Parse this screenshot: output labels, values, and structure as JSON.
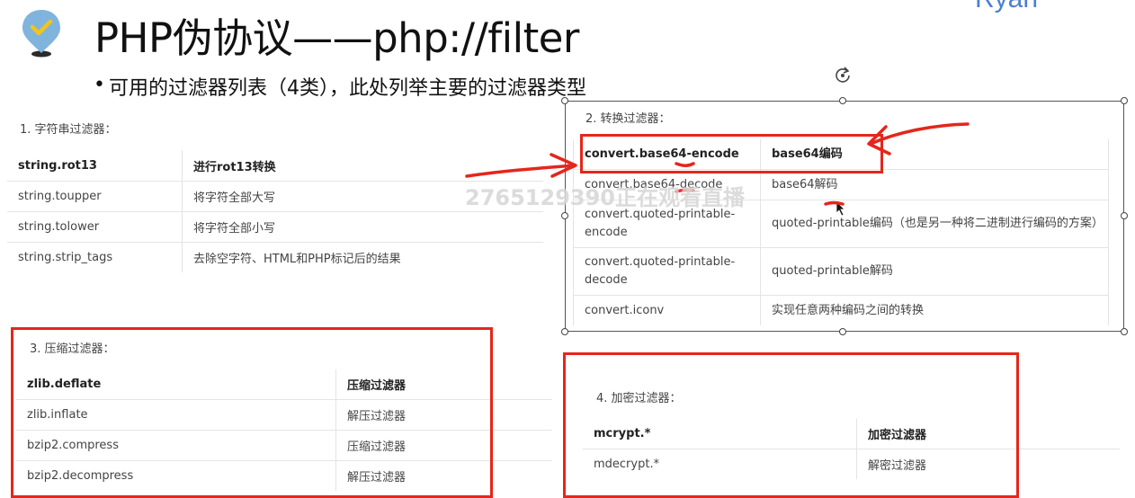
{
  "header": {
    "title": "PHP伪协议——php://filter",
    "author": "Ryan",
    "bullet": "•",
    "subtitle": "可用的过滤器列表（4类），此处列举主要的过滤器类型"
  },
  "sections": {
    "string": {
      "title": "1. 字符串过滤器：",
      "rows": [
        [
          "string.rot13",
          "进行rot13转换"
        ],
        [
          "string.toupper",
          "将字符全部大写"
        ],
        [
          "string.tolower",
          "将字符全部小写"
        ],
        [
          "string.strip_tags",
          "去除空字符、HTML和PHP标记后的结果"
        ]
      ]
    },
    "convert": {
      "title": "2. 转换过滤器：",
      "rows": [
        [
          "convert.base64-encode",
          "base64编码"
        ],
        [
          "convert.base64-decode",
          "base64解码"
        ],
        [
          "convert.quoted-printable-encode",
          "quoted-printable编码（也是另一种将二进制进行编码的方案）"
        ],
        [
          "convert.quoted-printable-decode",
          "quoted-printable解码"
        ],
        [
          "convert.iconv",
          "实现任意两种编码之间的转换"
        ]
      ]
    },
    "compress": {
      "title": "3. 压缩过滤器：",
      "rows": [
        [
          "zlib.deflate",
          "压缩过滤器"
        ],
        [
          "zlib.inflate",
          "解压过滤器"
        ],
        [
          "bzip2.compress",
          "压缩过滤器"
        ],
        [
          "bzip2.decompress",
          "解压过滤器"
        ]
      ]
    },
    "encrypt": {
      "title": "4. 加密过滤器：",
      "rows": [
        [
          "mcrypt.*",
          "加密过滤器"
        ],
        [
          "mdecrypt.*",
          "解密过滤器"
        ]
      ]
    }
  },
  "watermark": "2765129390正在观看直播",
  "colors": {
    "annotation_red": "#e5261c",
    "author_blue": "#4a7fd1",
    "pin_blue": "#7fb4dc",
    "pin_yellow": "#f2c41c"
  },
  "icons": {
    "pin": "location-pin-check-icon",
    "rotate": "rotate-handle-icon",
    "cursor": "mouse-pointer-icon"
  }
}
